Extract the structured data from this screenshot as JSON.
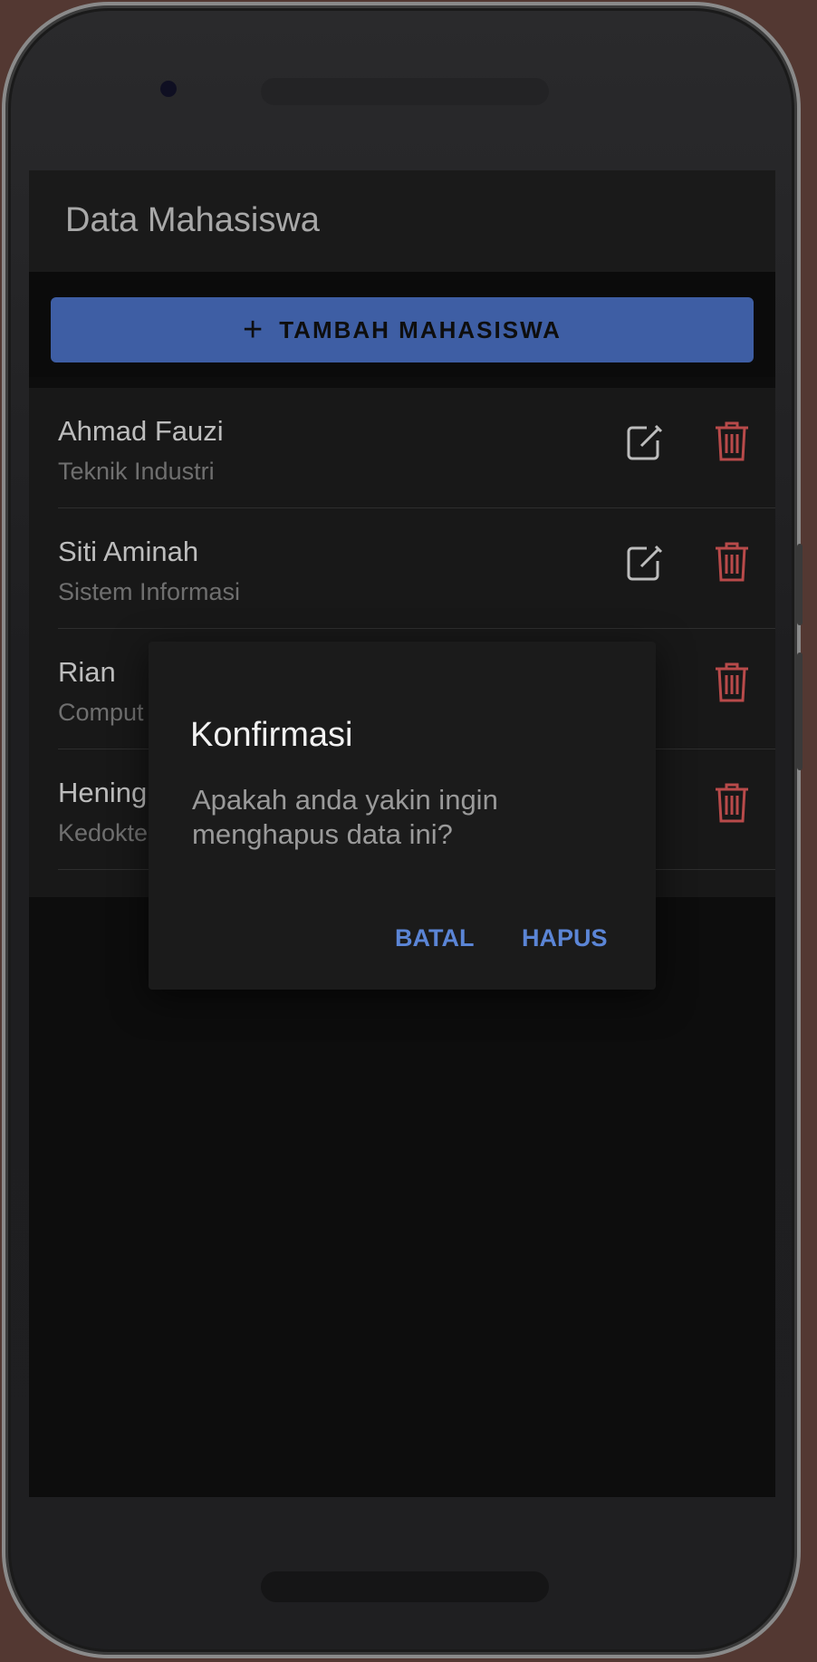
{
  "app": {
    "title": "Data Mahasiswa",
    "add_button_label": "TAMBAH MAHASISWA"
  },
  "students": [
    {
      "name": "Ahmad Fauzi",
      "program": "Teknik Industri"
    },
    {
      "name": "Siti Aminah",
      "program": "Sistem Informasi"
    },
    {
      "name": "Rian",
      "program": "Comput"
    },
    {
      "name": "Hening",
      "program": "Kedokte"
    }
  ],
  "dialog": {
    "title": "Konfirmasi",
    "message": "Apakah anda yakin ingin menghapus data ini?",
    "cancel_label": "BATAL",
    "confirm_label": "HAPUS"
  },
  "icons": {
    "add": "plus-icon",
    "edit": "edit-icon",
    "delete": "trash-icon"
  },
  "colors": {
    "accent": "#3e5ea4",
    "delete": "#b84a4a",
    "dialog_button": "#5b85d6"
  }
}
